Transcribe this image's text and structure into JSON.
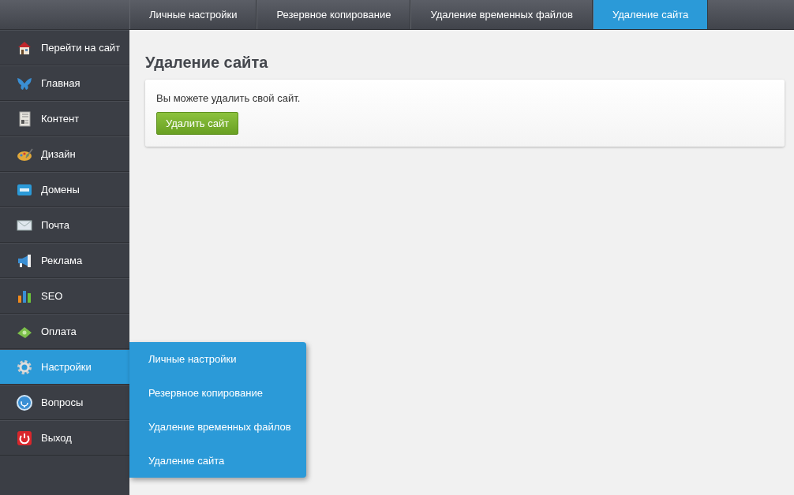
{
  "top_tabs": [
    {
      "label": "Личные настройки",
      "selected": false
    },
    {
      "label": "Резервное копирование",
      "selected": false
    },
    {
      "label": "Удаление временных файлов",
      "selected": false
    },
    {
      "label": "Удаление сайта",
      "selected": true
    }
  ],
  "sidebar": {
    "items": [
      {
        "label": "Перейти на сайт",
        "selected": false
      },
      {
        "label": "Главная",
        "selected": false
      },
      {
        "label": "Контент",
        "selected": false
      },
      {
        "label": "Дизайн",
        "selected": false
      },
      {
        "label": "Домены",
        "selected": false
      },
      {
        "label": "Почта",
        "selected": false
      },
      {
        "label": "Реклама",
        "selected": false
      },
      {
        "label": "SEO",
        "selected": false
      },
      {
        "label": "Оплата",
        "selected": false
      },
      {
        "label": "Настройки",
        "selected": true
      },
      {
        "label": "Вопросы",
        "selected": false
      },
      {
        "label": "Выход",
        "selected": false
      }
    ]
  },
  "submenu": {
    "items": [
      "Личные настройки",
      "Резервное копирование",
      "Удаление временных файлов",
      "Удаление сайта"
    ]
  },
  "page": {
    "title": "Удаление сайта",
    "text": "Вы можете удалить свой сайт.",
    "button": "Удалить сайт"
  }
}
